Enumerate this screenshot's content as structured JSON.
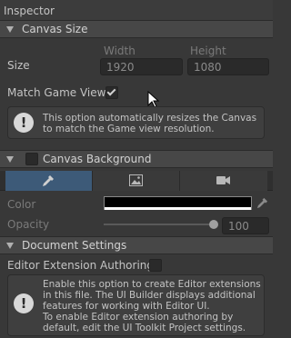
{
  "window": {
    "title": "Inspector"
  },
  "canvas_size": {
    "header": "Canvas Size",
    "size_label": "Size",
    "width_label": "Width",
    "height_label": "Height",
    "width_value": "1920",
    "height_value": "1080",
    "match_label": "Match Game View",
    "match_checked": true,
    "help_text": "This option automatically resizes the Canvas to match the Game view resolution."
  },
  "canvas_background": {
    "header": "Canvas Background",
    "enabled": false,
    "tabs": [
      {
        "icon": "eyedropper-icon",
        "active": true
      },
      {
        "icon": "image-icon",
        "active": false
      },
      {
        "icon": "camera-icon",
        "active": false
      }
    ],
    "color_label": "Color",
    "color_value": "#000000",
    "opacity_label": "Opacity",
    "opacity_value": "100",
    "opacity_fraction": 1.0
  },
  "document_settings": {
    "header": "Document Settings",
    "authoring_label": "Editor Extension Authoring",
    "authoring_checked": false,
    "help_text": "Enable this option to create Editor extensions in this file. The UI Builder displays additional features for working with Editor UI.\nTo enable Editor extension authoring by default, edit the UI Toolkit Project settings."
  }
}
